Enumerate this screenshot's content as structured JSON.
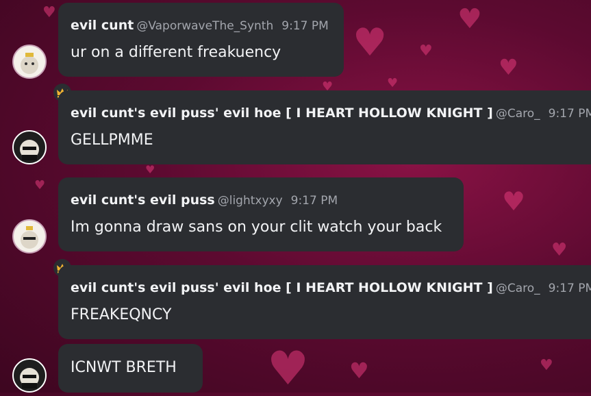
{
  "messages": [
    {
      "username": "evil cunt",
      "handle": "@VaporwaveThe_Synth",
      "time": "9:17 PM",
      "text": "ur on a different freakuency"
    },
    {
      "username": "evil cunt's evil puss' evil hoe [ I HEART HOLLOW KNIGHT ]",
      "handle": "@Caro_",
      "time": "9:17 PM",
      "text": "GELLPMME"
    },
    {
      "username": "evil cunt's evil puss",
      "handle": "@lightxyxy",
      "time": "9:17 PM",
      "text": "Im gonna draw sans on your clit watch your back"
    },
    {
      "username": "evil cunt's evil puss' evil hoe [ I HEART HOLLOW KNIGHT ]",
      "handle": "@Caro_",
      "time": "9:17 PM",
      "text": "FREAKEQNCY"
    },
    {
      "text": "ICNWT BRETH"
    }
  ],
  "colors": {
    "bubble": "#2b2d31",
    "background": "#5c0a30",
    "crown": "#f0b232",
    "heart": "#e23a7a"
  },
  "icons": {
    "crown": "crown-icon",
    "heart": "heart-icon"
  }
}
